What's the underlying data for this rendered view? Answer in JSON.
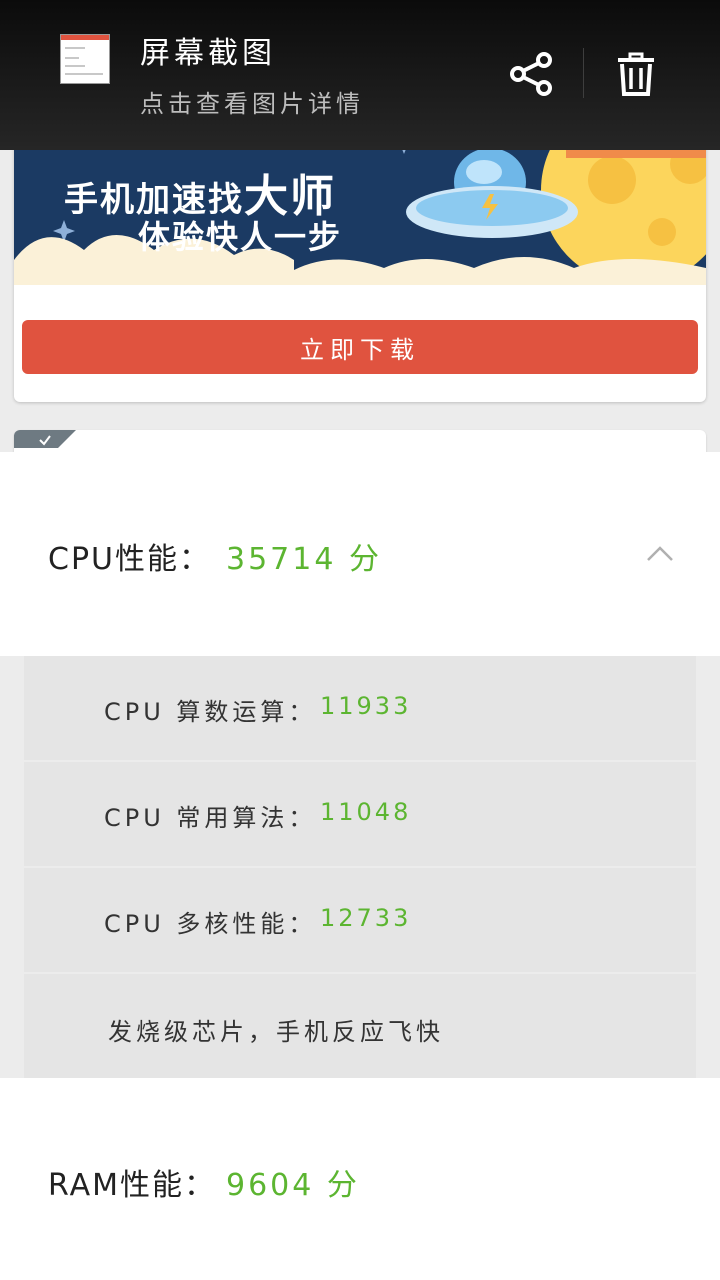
{
  "header": {
    "title": "屏幕截图",
    "subtitle": "点击查看图片详情",
    "share_icon": "share-icon",
    "delete_icon": "trash-icon"
  },
  "ad": {
    "banner_line1_a": "手机加速找",
    "banner_line1_b": "大师",
    "banner_line2": "体验快人一步",
    "download_label": "立即下载"
  },
  "cpu": {
    "label": "CPU性能：",
    "score": "35714 分",
    "details": [
      {
        "label": "CPU  算数运算：",
        "value": "11933"
      },
      {
        "label": "CPU  常用算法：",
        "value": "11048"
      },
      {
        "label": "CPU  多核性能：",
        "value": "12733"
      }
    ],
    "note": "发烧级芯片，手机反应飞快"
  },
  "ram": {
    "label": "RAM性能：",
    "score": "9604 分"
  },
  "colors": {
    "accent_green": "#5cb531",
    "download_red": "#e0533f",
    "banner_navy": "#1b3a63",
    "moon_yellow": "#fcd55c"
  }
}
